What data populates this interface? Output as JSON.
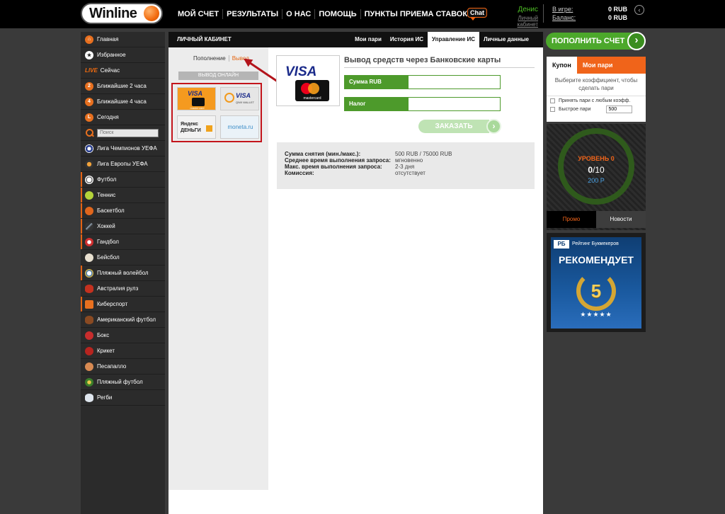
{
  "header": {
    "logo_text": "Winline",
    "nav": [
      "МОЙ СЧЕТ",
      "РЕЗУЛЬТАТЫ",
      "О НАС",
      "ПОМОЩЬ",
      "ПУНКТЫ ПРИЕМА СТАВОК"
    ],
    "chat_label": "Chat",
    "username": "Денис",
    "cabinet_link": "Личный кабинет",
    "in_game_label": "В игре:",
    "in_game_value": "0 RUB",
    "balance_label": "Баланс:",
    "balance_value": "0 RUB"
  },
  "sidebar": {
    "items": [
      {
        "label": "Главная",
        "icon": "home-icon"
      },
      {
        "label": "Избранное",
        "icon": "star-icon"
      },
      {
        "label": "Сейчас",
        "prefix": "LIVE"
      },
      {
        "label": "Ближайшие 2 часа",
        "icon": "two-hours-icon",
        "badge": "2"
      },
      {
        "label": "Ближайшие 4 часа",
        "icon": "four-hours-icon",
        "badge": "4"
      },
      {
        "label": "Сегодня",
        "icon": "today-icon",
        "badge": "L"
      }
    ],
    "search_placeholder": "Поиск",
    "leagues": [
      "Лига Чемпионов УЕФА",
      "Лига Европы УЕФА"
    ],
    "sports": [
      "Футбол",
      "Теннис",
      "Баскетбол",
      "Хоккей",
      "Гандбол",
      "Бейсбол",
      "Пляжный волейбол",
      "Австралия рулз",
      "Киберспорт",
      "Американский футбол",
      "Бокс",
      "Крикет",
      "Песапалло",
      "Пляжный футбол",
      "Регби"
    ]
  },
  "main": {
    "title": "ЛИЧНЫЙ КАБИНЕТ",
    "tabs": [
      "Мои пари",
      "История ИС",
      "Управление ИС",
      "Личные данные"
    ],
    "active_tab": "Управление ИС",
    "subtabs": [
      "Пополнение",
      "Вывод"
    ],
    "online_header": "ВЫВОД ОНЛАЙН",
    "methods": [
      {
        "name": "VISA",
        "sub": "mastercard"
      },
      {
        "name": "VISA",
        "sub": "QIWI WALLET"
      },
      {
        "name": "Яндекс ДЕНЬГИ"
      },
      {
        "name": "moneta.ru"
      }
    ],
    "card_logo": {
      "visa": "VISA",
      "mc": "mastercard"
    },
    "form_title": "Вывод средств через Банковские карты",
    "amount_label": "Сумма RUB",
    "tax_label": "Налог",
    "submit_label": "ЗАКАЗАТЬ",
    "info": [
      {
        "k": "Сумма снятия (мин./макс.):",
        "v": "500 RUB / 75000 RUB"
      },
      {
        "k": "Среднее время выполнения запроса:",
        "v": "мгновенно"
      },
      {
        "k": "Макс. время выполнения запроса:",
        "v": "2-3 дня"
      },
      {
        "k": "Комиссия:",
        "v": "отсутствует"
      }
    ]
  },
  "right": {
    "topup_label": "ПОПОЛНИТЬ СЧЕТ",
    "coupon_tabs": [
      "Купон",
      "Мои пари"
    ],
    "coupon_hint": "Выберите коэффициент, чтобы сделать пари",
    "accept_any": "Принять пари с любым коэфф.",
    "quick_bet": "Быстрое пари",
    "quick_bet_value": "500",
    "level_title": "УРОВЕНЬ 0",
    "level_current": "0",
    "level_total": "/10",
    "level_points": "200 Р",
    "promo_tabs": [
      "Промо",
      "Новости"
    ],
    "ad_rb": "РБ",
    "ad_rating": "Рейтинг Букмекеров",
    "ad_recommend": "РЕКОМЕНДУЕТ",
    "ad_score": "5",
    "ad_stars": "★★★★★"
  },
  "colors": {
    "accent": "#f0641a",
    "green": "#4ca82b",
    "red_frame": "#c3141b"
  }
}
